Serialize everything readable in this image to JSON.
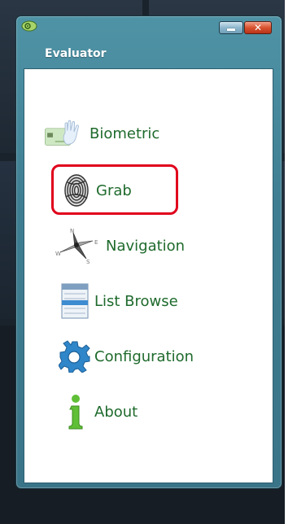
{
  "window": {
    "title": "Evaluator",
    "minimize_label": "Minimize",
    "close_label": "Close"
  },
  "menu": {
    "items": [
      {
        "label": "Biometric",
        "icon": "hand-card-icon"
      },
      {
        "label": "Grab",
        "icon": "fingerprint-icon",
        "highlighted": true
      },
      {
        "label": "Navigation",
        "icon": "compass-icon"
      },
      {
        "label": "List Browse",
        "icon": "list-icon"
      },
      {
        "label": "Configuration",
        "icon": "gear-icon"
      },
      {
        "label": "About",
        "icon": "info-icon"
      }
    ]
  },
  "colors": {
    "label_green": "#1e6a2c",
    "highlight_red": "#e0001b",
    "titlebar_teal": "#4f93a6",
    "desktop_dark": "#1a232c"
  }
}
